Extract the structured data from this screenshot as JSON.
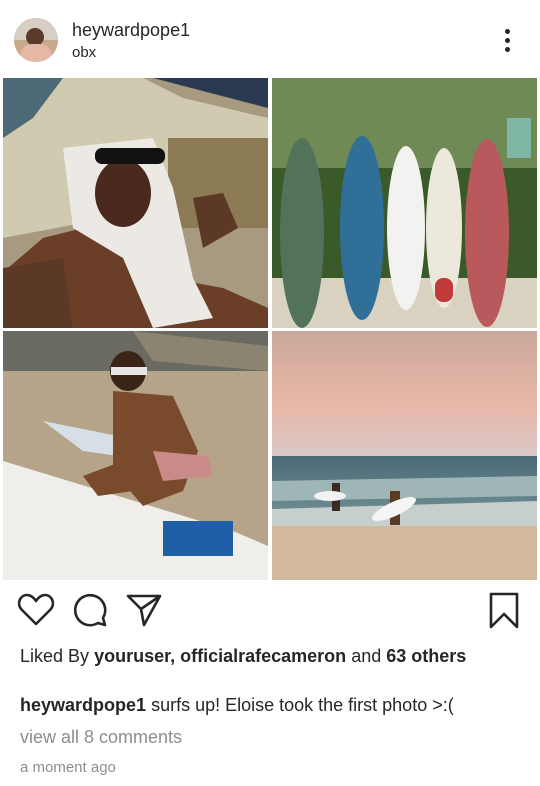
{
  "post": {
    "username": "heywardpope1",
    "location": "obx"
  },
  "likes": {
    "prefix": "Liked By",
    "names": "youruser, officialrafecameron",
    "joiner": "and",
    "count": "63",
    "suffix": "others"
  },
  "caption": {
    "username": "heywardpope1",
    "text": "surfs up! Eloise took the first photo >:("
  },
  "comments_link": "view all 8 comments",
  "timestamp": "a moment ago",
  "icons": {
    "more": "more-options-icon",
    "like": "heart-icon",
    "comment": "comment-bubble-icon",
    "share": "paper-plane-icon",
    "save": "bookmark-icon"
  },
  "colors": {
    "text": "#262626",
    "secondary": "#8e8e8e"
  }
}
